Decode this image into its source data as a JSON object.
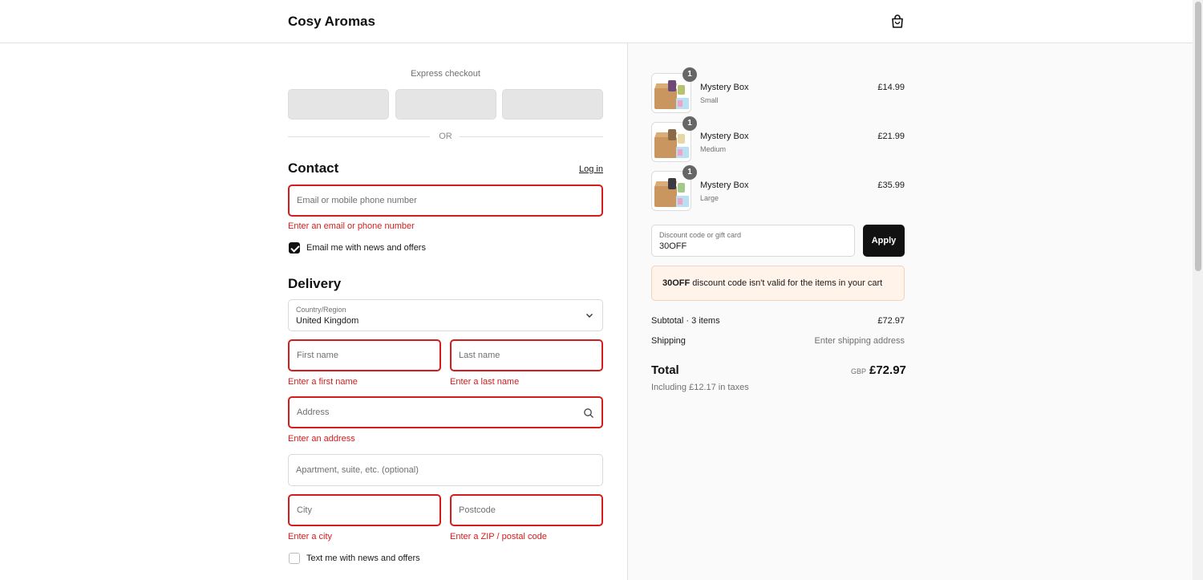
{
  "header": {
    "brand": "Cosy Aromas",
    "cart_icon": "shopping-bag-icon"
  },
  "express": {
    "label": "Express checkout",
    "or_text": "OR"
  },
  "contact": {
    "heading": "Contact",
    "login_link": "Log in",
    "email_placeholder": "Email or mobile phone number",
    "email_value": "",
    "email_error": "Enter an email or phone number",
    "newsletter_label": "Email me with news and offers",
    "newsletter_checked": true
  },
  "delivery": {
    "heading": "Delivery",
    "country_label": "Country/Region",
    "country_value": "United Kingdom",
    "first_name_placeholder": "First name",
    "first_name_error": "Enter a first name",
    "last_name_placeholder": "Last name",
    "last_name_error": "Enter a last name",
    "address_placeholder": "Address",
    "address_error": "Enter an address",
    "apartment_placeholder": "Apartment, suite, etc. (optional)",
    "city_placeholder": "City",
    "city_error": "Enter a city",
    "postcode_placeholder": "Postcode",
    "postcode_error": "Enter a ZIP / postal code",
    "sms_label": "Text me with news and offers",
    "sms_checked": false
  },
  "summary": {
    "items": [
      {
        "name": "Mystery Box",
        "variant": "Small",
        "price": "£14.99",
        "qty": "1"
      },
      {
        "name": "Mystery Box",
        "variant": "Medium",
        "price": "£21.99",
        "qty": "1"
      },
      {
        "name": "Mystery Box",
        "variant": "Large",
        "price": "£35.99",
        "qty": "1"
      }
    ],
    "discount_label": "Discount code or gift card",
    "discount_value": "30OFF",
    "apply_label": "Apply",
    "notice_code": "30OFF",
    "notice_text": " discount code isn't valid for the items in your cart",
    "subtotal_label": "Subtotal · 3 items",
    "subtotal_value": "£72.97",
    "shipping_label": "Shipping",
    "shipping_value": "Enter shipping address",
    "total_label": "Total",
    "total_currency": "GBP",
    "total_value": "£72.97",
    "tax_note": "Including £12.17 in taxes"
  },
  "colors": {
    "error": "#d41c1c",
    "primary_button": "#111111",
    "notice_bg": "#fff3ea"
  }
}
